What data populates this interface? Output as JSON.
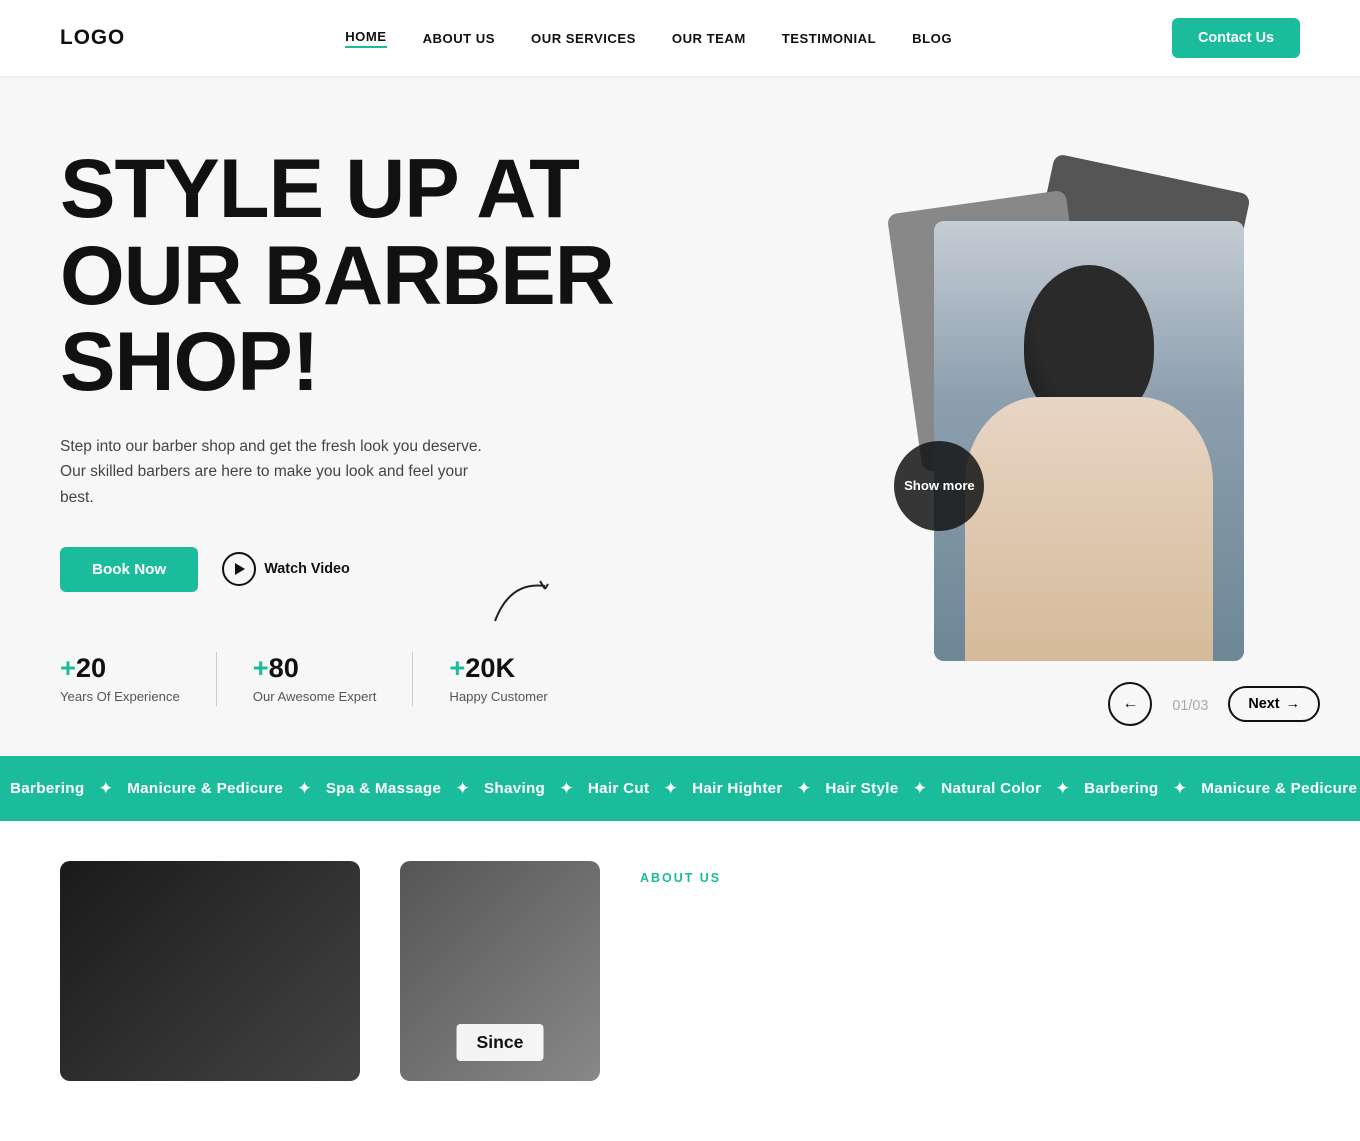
{
  "header": {
    "logo": "LOGO",
    "nav": [
      {
        "label": "HOME",
        "href": "#",
        "active": true
      },
      {
        "label": "ABOUT US",
        "href": "#",
        "active": false
      },
      {
        "label": "OUR SERVICES",
        "href": "#",
        "active": false
      },
      {
        "label": "OUR TEAM",
        "href": "#",
        "active": false
      },
      {
        "label": "TESTIMONIAL",
        "href": "#",
        "active": false
      },
      {
        "label": "BLOG",
        "href": "#",
        "active": false
      }
    ],
    "contact_button": "Contact Us"
  },
  "hero": {
    "title": "STYLE UP AT OUR BARBER SHOP!",
    "description": "Step into our barber shop and get the fresh look you deserve. Our skilled barbers are here to make you look and feel your best.",
    "book_button": "Book Now",
    "video_button": "Watch Video",
    "show_more": "Show more",
    "stats": [
      {
        "number": "+20",
        "label": "Years Of Experience"
      },
      {
        "number": "+80",
        "label": "Our Awesome Expert"
      },
      {
        "number": "+20K",
        "label": "Happy Customer"
      }
    ],
    "pagination": {
      "back": "Back",
      "next": "Next",
      "current": "01/",
      "total": "03"
    }
  },
  "services_ticker": {
    "items": [
      "Barbering",
      "Manicure & Pedicure",
      "Spa & Massage",
      "Shaving",
      "Hair Cut",
      "Hair Highter",
      "Hair Style",
      "Natural Color"
    ],
    "separator": "✦"
  },
  "about": {
    "label": "ABOUT US",
    "since_badge": "Since"
  },
  "colors": {
    "primary": "#1abc9c",
    "dark": "#111111",
    "light_bg": "#f7f7f7"
  }
}
